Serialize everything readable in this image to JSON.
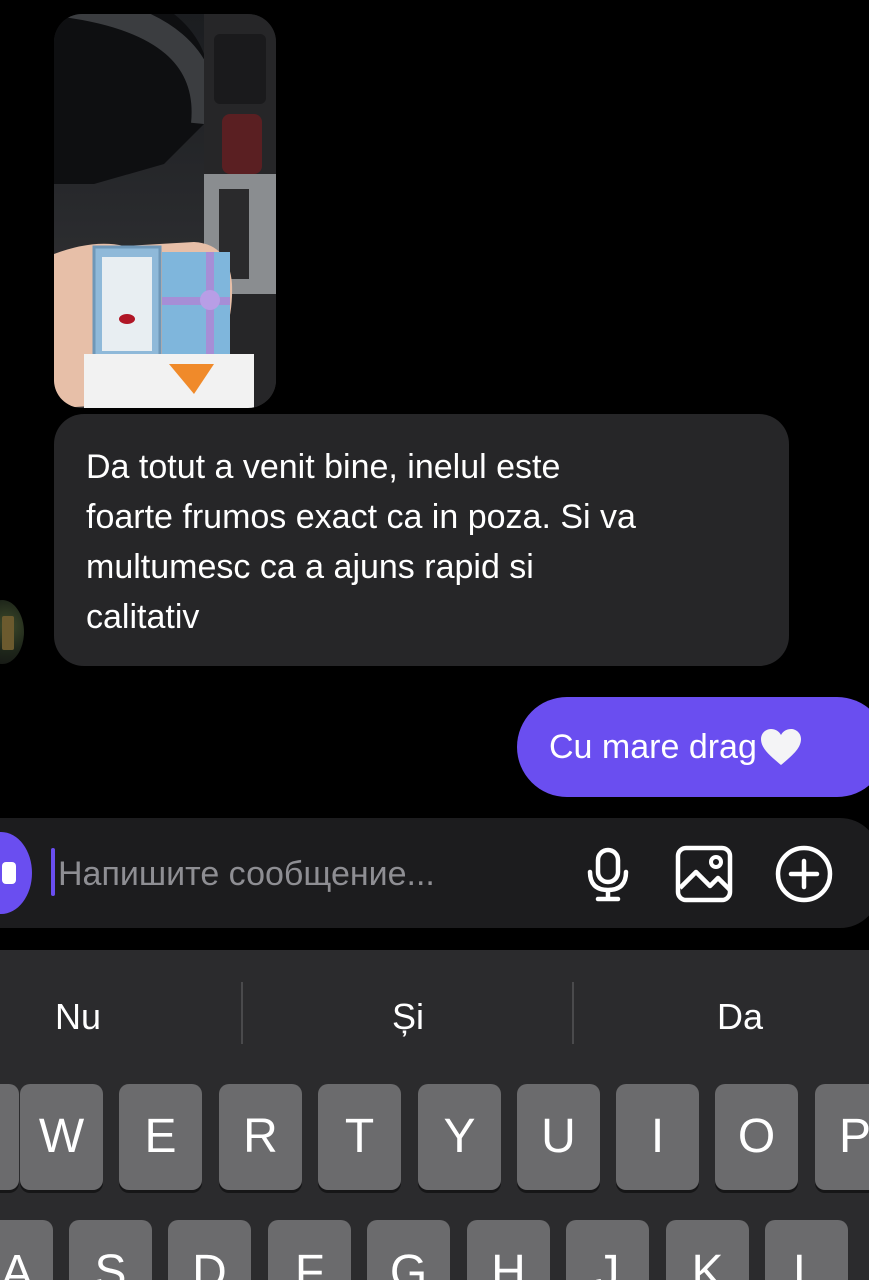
{
  "chat": {
    "photo_message": {
      "description_icon": "image-icon"
    },
    "incoming_lines": [
      "Da totut a venit bine, inelul este",
      "foarte frumos exact ca in poza. Si va",
      "multumesc ca a ajuns rapid si",
      "calitativ"
    ],
    "outgoing_text": "Cu mare drag"
  },
  "composer": {
    "placeholder": "Напишите сообщение...",
    "icons": [
      "microphone-icon",
      "image-icon",
      "plus-circle-icon"
    ]
  },
  "keyboard": {
    "suggestions": [
      "Nu",
      "Și",
      "Da"
    ],
    "row1": [
      "W",
      "E",
      "R",
      "T",
      "Y",
      "U",
      "I",
      "O",
      "P"
    ],
    "row2": [
      "A",
      "S",
      "D",
      "F",
      "G",
      "H",
      "J",
      "K",
      "L"
    ]
  },
  "colors": {
    "accent": "#6a4ef0",
    "incoming_bubble": "#262628",
    "keyboard_bg": "#2b2b2d",
    "key": "#6b6b6d"
  }
}
